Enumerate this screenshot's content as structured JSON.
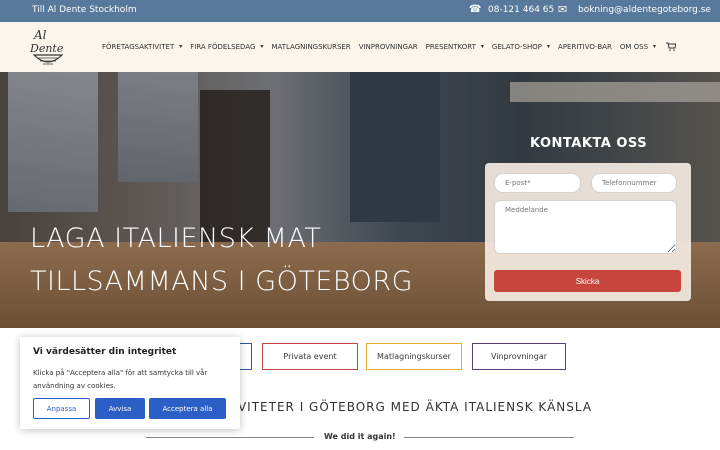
{
  "topbar": {
    "stockholm_link": "Till Al Dente Stockholm",
    "phone": "08-121 464 65",
    "email": "bokning@aldentegoteborg.se",
    "bg_color": "#58799b"
  },
  "nav": {
    "items": [
      {
        "label": "FÖRETAGSAKTIVITET",
        "has_dropdown": true
      },
      {
        "label": "FIRA FÖDELSEDAG",
        "has_dropdown": true
      },
      {
        "label": "MATLAGNINGSKURSER",
        "has_dropdown": false
      },
      {
        "label": "VINPROVNINGAR",
        "has_dropdown": false
      },
      {
        "label": "PRESENTKORT",
        "has_dropdown": true
      },
      {
        "label": "GELATO-SHOP",
        "has_dropdown": true
      },
      {
        "label": "APERITIVO-BAR",
        "has_dropdown": false
      },
      {
        "label": "OM OSS",
        "has_dropdown": true
      }
    ],
    "caret": "▾",
    "cart_icon": "cart-icon"
  },
  "hero": {
    "line1": "LAGA ITALIENSK MAT",
    "line2": "TILLSAMMANS I GÖTEBORG"
  },
  "contact_form": {
    "title": "KONTAKTA OSS",
    "email_placeholder": "E-post*",
    "phone_placeholder": "Telefonnummer",
    "message_placeholder": "Meddelande",
    "submit_label": "Skicka",
    "submit_color": "#c7453c"
  },
  "categories": [
    {
      "label": ""
    },
    {
      "label": "Privata event"
    },
    {
      "label": "Matlagningskurser"
    },
    {
      "label": "Vinprovningar"
    }
  ],
  "section": {
    "headline_visible": "AKTIVITETER I GÖTEBORG MED ÄKTA ITALIENSK KÄNSLA",
    "tagline": "We did it again!"
  },
  "cookie_banner": {
    "title": "Vi värdesätter din integritet",
    "text": "Klicka på \"Acceptera alla\" för att samtycka till vår användning av cookies.",
    "adjust_label": "Anpassa",
    "reject_label": "Avvisa",
    "accept_label": "Acceptera alla",
    "button_color": "#2c5fc6"
  }
}
